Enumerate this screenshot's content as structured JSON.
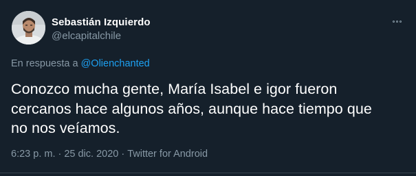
{
  "tweet": {
    "author": {
      "name": "Sebastián Izquierdo",
      "handle": "@elcapitalchile"
    },
    "reply_prefix": "En respuesta a",
    "reply_to": "@Olienchanted",
    "text_lines": [
      "Conozco mucha gente, María Isabel e igor fueron",
      "cercanos hace algunos años, aunque hace tiempo que",
      "no nos veíamos."
    ],
    "time": "6:23 p. m.",
    "separator": "·",
    "date": "25 dic. 2020",
    "source": "Twitter for Android"
  },
  "icons": {
    "more": "more-options-icon",
    "avatar": "profile-photo"
  },
  "colors": {
    "background": "#15202b",
    "primary_text": "#ffffff",
    "secondary_text": "#8899a6",
    "link": "#1da1f2",
    "divider": "#38444d"
  }
}
